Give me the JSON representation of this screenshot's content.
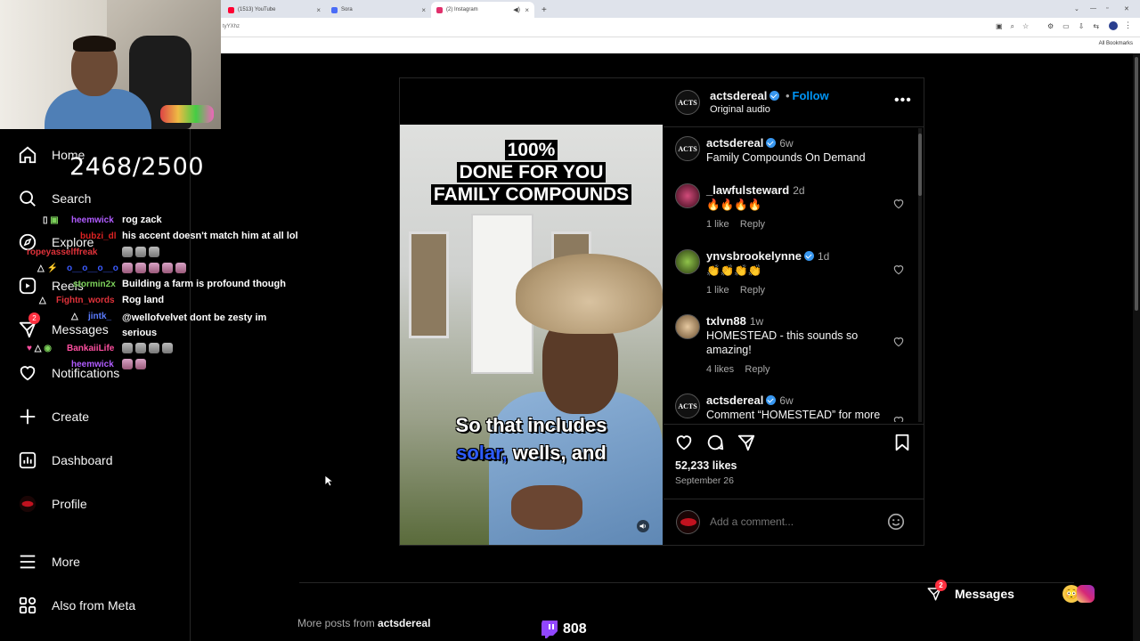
{
  "browser": {
    "tabs": [
      {
        "title": "(1513) YouTube",
        "color": "#ff0033"
      },
      {
        "title": "Sora",
        "color": "#4a6cf7"
      },
      {
        "title": "(2) Instagram",
        "color": "#e1306c"
      }
    ],
    "new_tab": "+",
    "url_fragment": "tyYXhz",
    "all_bookmarks": "All Bookmarks"
  },
  "stream": {
    "sub_goal": "2468/2500",
    "viewer_count": "808",
    "chat": [
      {
        "user": "heemwick",
        "user_color": "#b05cff",
        "text": "rog zack"
      },
      {
        "user": "bubzi_dl",
        "user_color": "#d22",
        "text": "his accent doesn't match him at all lol"
      },
      {
        "user": "ropeyasselffreak",
        "user_color": "#e0323a",
        "text": ""
      },
      {
        "user": "o__o__o__o",
        "user_color": "#3b5bff",
        "text": ""
      },
      {
        "user": "stormin2x",
        "user_color": "#7cd15a",
        "text": "Building a farm is profound though"
      },
      {
        "user": "Fightn_words",
        "user_color": "#e0323a",
        "text": "Rog land"
      },
      {
        "user": "jintk_",
        "user_color": "#5a7bff",
        "text": "@wellofvelvet dont be zesty im serious"
      },
      {
        "user": "BankaiiLife",
        "user_color": "#ff4fa0",
        "text": ""
      },
      {
        "user": "heemwick",
        "user_color": "#b05cff",
        "text": ""
      }
    ]
  },
  "sidebar": {
    "items": [
      {
        "label": "Home",
        "icon": "home-icon"
      },
      {
        "label": "Search",
        "icon": "search-icon"
      },
      {
        "label": "Explore",
        "icon": "compass-icon"
      },
      {
        "label": "Reels",
        "icon": "reels-icon"
      },
      {
        "label": "Messages",
        "icon": "messenger-icon",
        "badge": "2"
      },
      {
        "label": "Notifications",
        "icon": "heart-icon"
      },
      {
        "label": "Create",
        "icon": "plus-icon"
      },
      {
        "label": "Dashboard",
        "icon": "dashboard-icon"
      },
      {
        "label": "Profile",
        "icon": "profile-avatar"
      },
      {
        "label": "More",
        "icon": "menu-icon"
      },
      {
        "label": "Also from Meta",
        "icon": "meta-icon"
      }
    ]
  },
  "post": {
    "author": "actsdereal",
    "follow_label": "Follow",
    "audio": "Original audio",
    "avatar_text": "ACTS",
    "video_caption_top": [
      "100%",
      "DONE FOR YOU",
      "FAMILY COMPOUNDS"
    ],
    "video_caption_bottom_line1": "So that includes",
    "video_caption_bottom_hl": "solar,",
    "video_caption_bottom_rest": " wells, and",
    "caption": {
      "user": "actsdereal",
      "time": "6w",
      "text": "Family Compounds On Demand"
    },
    "comments": [
      {
        "user": "_lawfulsteward",
        "time": "2d",
        "text": "🔥🔥🔥🔥",
        "likes": "1 like",
        "reply": "Reply",
        "verified": false
      },
      {
        "user": "ynvsbrookelynne",
        "time": "1d",
        "text": "👏👏👏👏",
        "likes": "1 like",
        "reply": "Reply",
        "verified": true
      },
      {
        "user": "txlvn88",
        "time": "1w",
        "text": "HOMESTEAD - this sounds so amazing!",
        "likes": "4 likes",
        "reply": "Reply",
        "verified": false
      },
      {
        "user": "actsdereal",
        "time": "6w",
        "text": "Comment “HOMESTEAD” for more",
        "likes": "",
        "reply": "",
        "verified": true
      }
    ],
    "likes": "52,233 likes",
    "date": "September 26",
    "add_comment_placeholder": "Add a comment..."
  },
  "footer": {
    "more_posts_prefix": "More posts from ",
    "more_posts_user": "actsdereal",
    "messages_label": "Messages",
    "messages_badge": "2"
  }
}
